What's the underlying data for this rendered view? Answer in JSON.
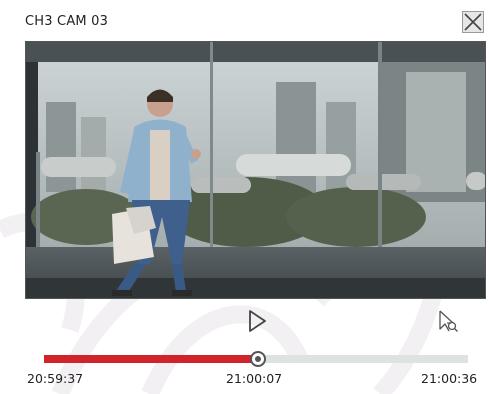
{
  "window": {
    "title": "CH3 CAM 03"
  },
  "icons": {
    "close": "close-icon",
    "play": "play-icon",
    "search": "search-icon"
  },
  "playback": {
    "start_time": "20:59:37",
    "current_time": "21:00:07",
    "end_time": "21:00:36",
    "progress_fraction": 0.5
  },
  "colors": {
    "progress": "#d1232a",
    "track": "#dde3df"
  }
}
